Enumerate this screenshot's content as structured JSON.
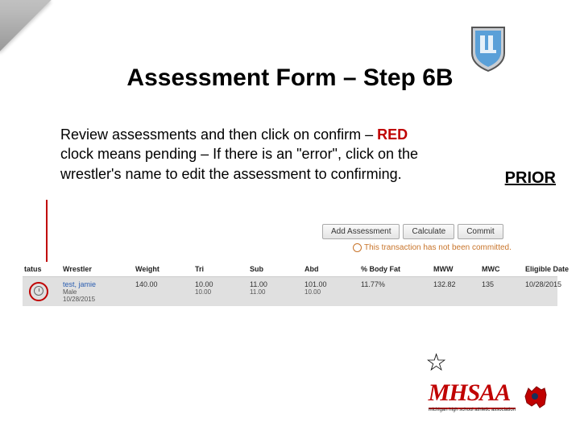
{
  "title": "Assessment Form – Step 6B",
  "body": {
    "line1": "Review assessments and then click on confirm – ",
    "red": "RED",
    "line2": " clock means pending – If there is an \"error\", click on the wrestler's name to edit the assessment to confirming."
  },
  "prior": "PRIOR",
  "buttons": {
    "add": "Add Assessment",
    "calc": "Calculate",
    "commit": "Commit"
  },
  "commit_note": "This transaction has not been committed.",
  "table": {
    "headers": {
      "status": "tatus",
      "wrestler": "Wrestler",
      "weight": "Weight",
      "tri": "Tri",
      "sub": "Sub",
      "abd": "Abd",
      "bodyfat": "% Body Fat",
      "mww": "MWW",
      "mwc": "MWC",
      "eligible": "Eligible Date"
    },
    "row": {
      "wrestler_name": "test, jamie",
      "wrestler_gender": "Male",
      "wrestler_date": "10/28/2015",
      "weight": "140.00",
      "tri1": "10.00",
      "tri2": "10.00",
      "sub1": "11.00",
      "sub2": "11.00",
      "abd1": "101.00",
      "abd2": "10.00",
      "bodyfat": "11.77%",
      "mww": "132.82",
      "mwc": "135",
      "eligible": "10/28/2015"
    }
  },
  "logo": {
    "text": "MHSAA",
    "sub": "michigan high school athletic association"
  }
}
